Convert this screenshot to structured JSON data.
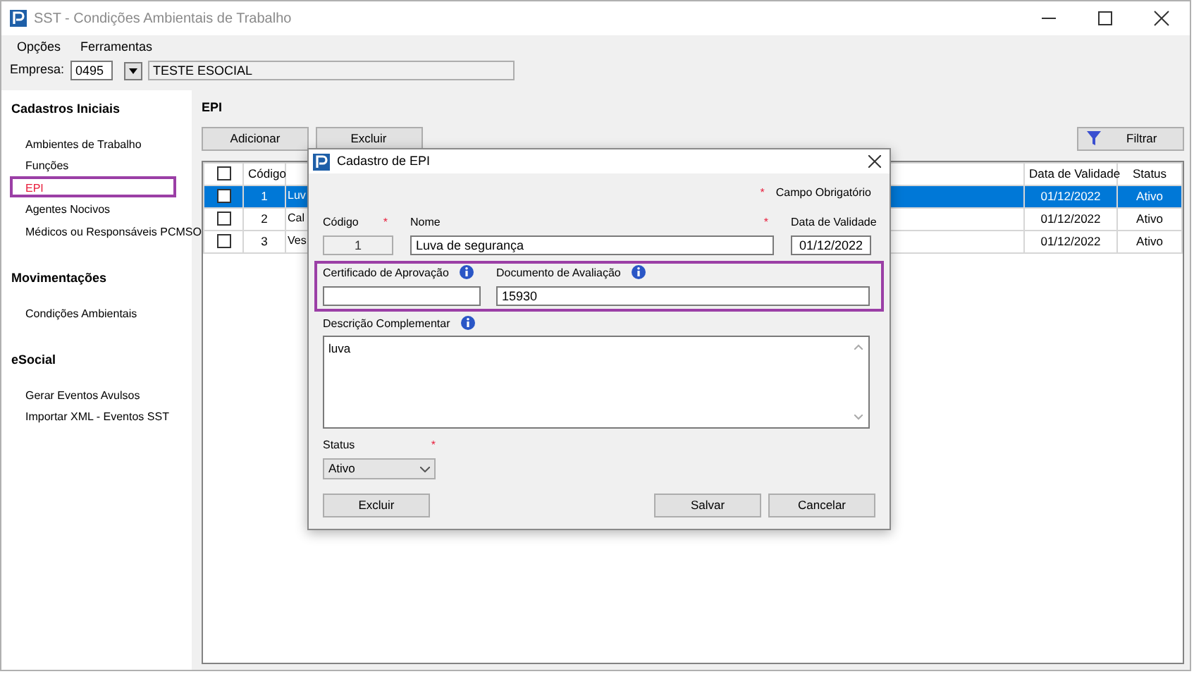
{
  "window": {
    "title": "SST - Condições Ambientais de Trabalho"
  },
  "menu": [
    "Opções",
    "Ferramentas"
  ],
  "company": {
    "label": "Empresa:",
    "code": "0495",
    "name": "TESTE ESOCIAL"
  },
  "sidebar": [
    {
      "title": "Cadastros Iniciais",
      "items": [
        {
          "label": "Ambientes de Trabalho",
          "selected": false,
          "highlighted": false
        },
        {
          "label": "Funções",
          "selected": false,
          "highlighted": false
        },
        {
          "label": "EPI",
          "selected": true,
          "highlighted": true
        },
        {
          "label": "Agentes Nocivos",
          "selected": false,
          "highlighted": false
        },
        {
          "label": "Médicos ou Responsáveis PCMSO",
          "selected": false,
          "highlighted": false
        }
      ]
    },
    {
      "title": "Movimentações",
      "items": [
        {
          "label": "Condições Ambientais",
          "selected": false,
          "highlighted": false
        }
      ]
    },
    {
      "title": "eSocial",
      "items": [
        {
          "label": "Gerar Eventos Avulsos",
          "selected": false,
          "highlighted": false
        },
        {
          "label": "Importar XML - Eventos SST",
          "selected": false,
          "highlighted": false
        }
      ]
    }
  ],
  "content": {
    "title": "EPI",
    "buttons": [
      "Adicionar",
      "Excluir"
    ],
    "filter_button": "Filtrar"
  },
  "table": {
    "all_checked": false,
    "columns": [
      {
        "kind": "check"
      },
      {
        "kind": "code",
        "label": "Código"
      },
      {
        "kind": "name"
      },
      {
        "kind": "date",
        "label": "Data de Validade"
      },
      {
        "kind": "status",
        "label": "Status"
      }
    ],
    "rows": [
      {
        "checked": false,
        "selected": true,
        "code": "1",
        "name": "Luv",
        "date": "01/12/2022",
        "status": "Ativo"
      },
      {
        "checked": false,
        "selected": false,
        "code": "2",
        "name": "Cal",
        "date": "01/12/2022",
        "status": "Ativo"
      },
      {
        "checked": false,
        "selected": false,
        "code": "3",
        "name": "Ves",
        "date": "01/12/2022",
        "status": "Ativo"
      }
    ]
  },
  "dialog": {
    "title": "Cadastro de EPI",
    "required_mark": "*",
    "required_note": "Campo Obrigatório",
    "code": {
      "label": "Código",
      "required_mark": "*",
      "value": "1",
      "disabled": true
    },
    "name": {
      "label": "Nome",
      "required_mark": "*",
      "value": "Luva de segurança"
    },
    "date": {
      "label": "Data de Validade",
      "value": "01/12/2022"
    },
    "highlighted": true,
    "certificate": {
      "label": "Certificado de Aprovação"
    },
    "document": {
      "label": "Documento de Avaliação",
      "value": "15930"
    },
    "description": {
      "label": "Descrição Complementar",
      "value": "luva"
    },
    "status": {
      "label": "Status",
      "required_mark": "*",
      "value": "Ativo"
    },
    "buttons": {
      "delete": "Excluir",
      "save": "Salvar",
      "cancel": "Cancelar"
    }
  }
}
